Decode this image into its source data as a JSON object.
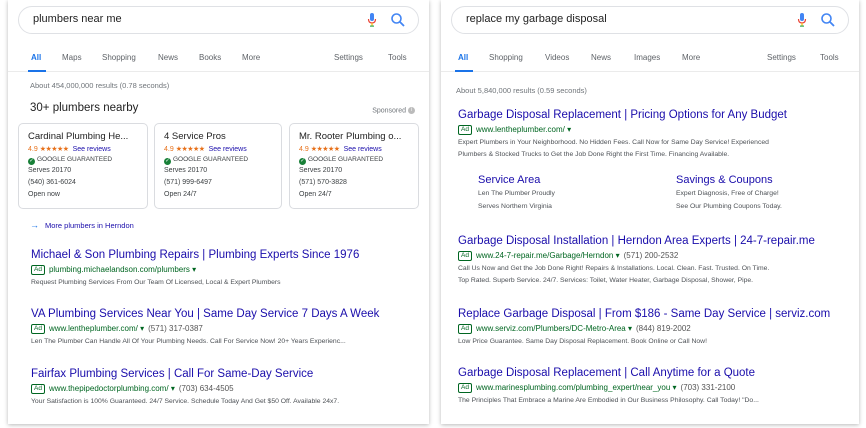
{
  "left": {
    "query": "plumbers near me",
    "tabs": [
      "All",
      "Maps",
      "Shopping",
      "News",
      "Books",
      "More",
      "Settings",
      "Tools"
    ],
    "stats": "About 454,000,000 results (0.78 seconds)",
    "local_title": "30+ plumbers nearby",
    "sponsored": "Sponsored",
    "cards": [
      {
        "name": "Cardinal Plumbing He...",
        "rating": "4.9",
        "stars": "★★★★★",
        "reviews": "See reviews",
        "guarantee": "GOOGLE GUARANTEED",
        "serves": "Serves 20170",
        "phone": "(540) 361-6024",
        "hours": "Open now"
      },
      {
        "name": "4 Service Pros",
        "rating": "4.9",
        "stars": "★★★★★",
        "reviews": "See reviews",
        "guarantee": "GOOGLE GUARANTEED",
        "serves": "Serves 20170",
        "phone": "(571) 999-6497",
        "hours": "Open 24/7"
      },
      {
        "name": "Mr. Rooter Plumbing o...",
        "rating": "4.9",
        "stars": "★★★★★",
        "reviews": "See reviews",
        "guarantee": "GOOGLE GUARANTEED",
        "serves": "Serves 20170",
        "phone": "(571) 570-3828",
        "hours": "Open 24/7"
      }
    ],
    "more_link": "More plumbers in Herndon",
    "ads": [
      {
        "title": "Michael & Son Plumbing Repairs | Plumbing Experts Since 1976",
        "url": "plumbing.michaelandson.com/plumbers",
        "phone": "",
        "desc": "Request Plumbing Services From Our Team Of Licensed, Local & Expert Plumbers"
      },
      {
        "title": "VA Plumbing Services Near You | Same Day Service 7 Days A Week",
        "url": "www.lentheplumber.com/",
        "phone": "(571) 317-0387",
        "desc": "Len The Plumber Can Handle All Of Your Plumbing Needs. Call For Service Now! 20+ Years Experienc..."
      },
      {
        "title": "Fairfax Plumbing Services | Call For Same-Day Service",
        "url": "www.thepipedoctorplumbing.com/",
        "phone": "(703) 634-4505",
        "desc": "Your Satisfaction is 100% Guaranteed. 24/7 Service. Schedule Today And Get $50 Off. Available 24x7."
      }
    ]
  },
  "right": {
    "query": "replace my garbage disposal",
    "tabs": [
      "All",
      "Shopping",
      "Videos",
      "News",
      "Images",
      "More",
      "Settings",
      "Tools"
    ],
    "stats": "About 5,840,000 results (0.59 seconds)",
    "ads": [
      {
        "title": "Garbage Disposal Replacement | Pricing Options for Any Budget",
        "url": "www.lentheplumber.com/",
        "phone": "",
        "desc1": "Expert Plumbers in Your Neighborhood. No Hidden Fees. Call Now for Same Day Service! Experienced",
        "desc2": "Plumbers & Stocked Trucks to Get the Job Done Right the First Time. Financing Available."
      },
      {
        "title": "Garbage Disposal Installation | Herndon Area Experts | 24-7-repair.me",
        "url": "www.24-7-repair.me/Garbage/Herndon",
        "phone": "(571) 200-2532",
        "desc1": "Call Us Now and Get the Job Done Right! Repairs & Installations. Local. Clean. Fast. Trusted. On Time.",
        "desc2": "Top Rated. Superb Service. 24/7. Services: Toilet, Water Heater, Garbage Disposal, Shower, Pipe."
      },
      {
        "title": "Replace Garbage Disposal | From $186 - Same Day Service | serviz.com",
        "url": "www.serviz.com/Plumbers/DC-Metro-Area",
        "phone": "(844) 819-2002",
        "desc1": "Low Price Guarantee. Same Day Disposal Replacement. Book Online or Call Now!",
        "desc2": ""
      },
      {
        "title": "Garbage Disposal Replacement | Call Anytime for a Quote",
        "url": "www.marinesplumbing.com/plumbing_expert/near_you",
        "phone": "(703) 331-2100",
        "desc1": "The Principles That Embrace a Marine Are Embodied in Our Business Philosophy. Call Today! \"Do...",
        "desc2": ""
      }
    ],
    "sitelinks": [
      {
        "title": "Service Area",
        "line1": "Len The Plumber Proudly",
        "line2": "Serves Northern Virginia"
      },
      {
        "title": "Savings & Coupons",
        "line1": "Expert Diagnosis, Free of Charge!",
        "line2": "See Our Plumbing Coupons Today."
      }
    ]
  },
  "badge": "Ad",
  "colors": {
    "link": "#1a0dab",
    "url": "#006621",
    "accent": "#1a73e8",
    "star": "#e7711b",
    "guarantee": "#188038"
  }
}
